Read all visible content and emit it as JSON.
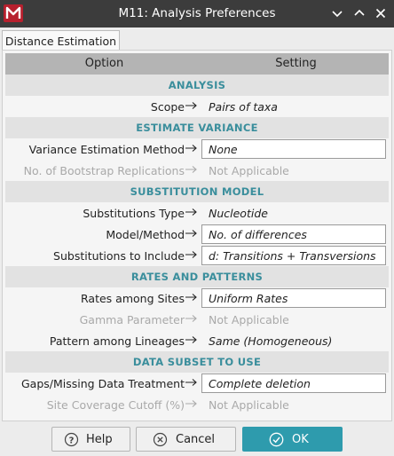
{
  "window": {
    "title": "M11: Analysis Preferences",
    "controls": {
      "minimize_icon": "chevron-down-icon",
      "maximize_icon": "chevron-up-icon",
      "close_icon": "close-icon"
    }
  },
  "tabs": [
    {
      "label": "Distance Estimation",
      "active": true
    }
  ],
  "grid": {
    "header": {
      "option": "Option",
      "setting": "Setting"
    },
    "sections": [
      {
        "title": "ANALYSIS",
        "rows": [
          {
            "label": "Scope",
            "value": "Pairs of taxa",
            "editable": false,
            "disabled": false
          }
        ]
      },
      {
        "title": "ESTIMATE VARIANCE",
        "rows": [
          {
            "label": "Variance Estimation Method",
            "value": "None",
            "editable": true,
            "disabled": false
          },
          {
            "label": "No.  of Bootstrap Replications",
            "value": "Not Applicable",
            "editable": false,
            "disabled": true
          }
        ]
      },
      {
        "title": "SUBSTITUTION MODEL",
        "rows": [
          {
            "label": "Substitutions Type",
            "value": "Nucleotide",
            "editable": false,
            "disabled": false
          },
          {
            "label": "Model/Method",
            "value": "No.  of differences",
            "editable": true,
            "disabled": false
          },
          {
            "label": "Substitutions to Include",
            "value": "d:  Transitions  +  Transversions",
            "editable": true,
            "disabled": false
          }
        ]
      },
      {
        "title": "RATES AND PATTERNS",
        "rows": [
          {
            "label": "Rates among Sites",
            "value": "Uniform Rates",
            "editable": true,
            "disabled": false
          },
          {
            "label": "Gamma Parameter",
            "value": "Not Applicable",
            "editable": false,
            "disabled": true
          },
          {
            "label": "Pattern among Lineages",
            "value": "Same  (Homogeneous)",
            "editable": false,
            "disabled": false
          }
        ]
      },
      {
        "title": "DATA SUBSET TO USE",
        "rows": [
          {
            "label": "Gaps/Missing Data Treatment",
            "value": "Complete deletion",
            "editable": true,
            "disabled": false
          },
          {
            "label": "Site Coverage Cutoff  (%)",
            "value": "Not Applicable",
            "editable": false,
            "disabled": true
          }
        ]
      }
    ]
  },
  "buttons": {
    "help": {
      "label": "Help",
      "icon": "help-icon"
    },
    "cancel": {
      "label": "Cancel",
      "icon": "cancel-icon"
    },
    "ok": {
      "label": "OK",
      "icon": "check-icon"
    }
  },
  "colors": {
    "title_bar": "#3c3c3c",
    "logo": "#b7202e",
    "section_title": "#3a8e9c",
    "ok_button": "#2e9bad",
    "header_row": "#b4b4b4"
  }
}
